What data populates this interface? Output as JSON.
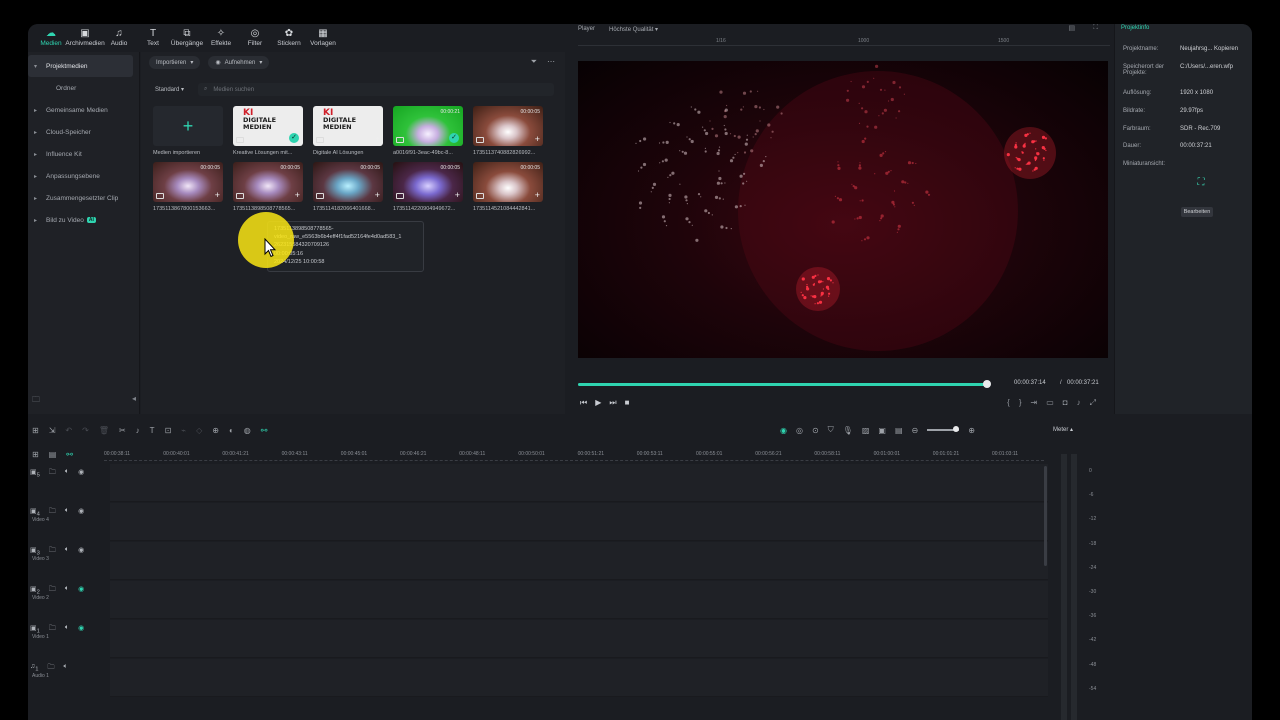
{
  "toolbar": {
    "items": [
      {
        "label": "Medien",
        "icon": "media-icon",
        "glyph": "☁"
      },
      {
        "label": "Archivmedien",
        "icon": "archive-icon",
        "glyph": "▣"
      },
      {
        "label": "Audio",
        "icon": "music-icon",
        "glyph": "♫"
      },
      {
        "label": "Text",
        "icon": "text-icon",
        "glyph": "T"
      },
      {
        "label": "Übergänge",
        "icon": "transition-icon",
        "glyph": "⧉"
      },
      {
        "label": "Effekte",
        "icon": "effects-icon",
        "glyph": "✧"
      },
      {
        "label": "Filter",
        "icon": "filter-icon",
        "glyph": "◎"
      },
      {
        "label": "Stickern",
        "icon": "sticker-icon",
        "glyph": "✿"
      },
      {
        "label": "Vorlagen",
        "icon": "template-icon",
        "glyph": "▦"
      }
    ]
  },
  "leftnav": {
    "items": [
      {
        "label": "Projektmedien",
        "caret": "▾",
        "selected": true
      },
      {
        "label": "Ordner",
        "sub": true
      },
      {
        "label": "Gemeinsame Medien",
        "caret": "▸"
      },
      {
        "label": "Cloud-Speicher",
        "caret": "▸"
      },
      {
        "label": "Influence Kit",
        "caret": "▸"
      },
      {
        "label": "Anpassungsebene",
        "caret": "▸"
      },
      {
        "label": "Zusammengesetzter Clip",
        "caret": "▸"
      },
      {
        "label": "Bild zu Video",
        "caret": "▸",
        "badge": "AI"
      }
    ]
  },
  "media": {
    "import_label": "Importieren",
    "record_label": "Aufnehmen",
    "sort_label": "Standard",
    "search_placeholder": "Medien suchen",
    "tiles": [
      {
        "label": "Medien importieren",
        "kind": "import"
      },
      {
        "label": "Kreative Lösungen mit...",
        "kind": "ki",
        "check": true
      },
      {
        "label": "Digitale AI Lösungen",
        "kind": "ki",
        "plus": true
      },
      {
        "label": "a0016f91-3eac-49bc-8...",
        "kind": "green",
        "duration": "00:00:21",
        "check": true
      },
      {
        "label": "1735113740882826992...",
        "kind": "brown",
        "duration": "00:00:05",
        "plus": true
      },
      {
        "label": "1735113867800153663...",
        "kind": "dancer",
        "duration": "00:00:05",
        "plus": true
      },
      {
        "label": "1735113898508778565...",
        "kind": "dancer",
        "duration": "00:00:05",
        "plus": true
      },
      {
        "label": "1735114182066401668...",
        "kind": "dancer2",
        "duration": "00:00:05",
        "plus": true
      },
      {
        "label": "1735114220904949672...",
        "kind": "dancer3",
        "duration": "00:00:05",
        "plus": true
      },
      {
        "label": "1735114521084442841...",
        "kind": "brown",
        "duration": "00:00:05",
        "plus": true
      }
    ],
    "ki_logo": {
      "top": "KI",
      "line1": "DIGITALE",
      "line2": "MEDIEN"
    },
    "tooltip": {
      "line1": "1735113898508778565-",
      "line2": "video_raw_e5563b6b4eff4f1fad52164fe4d0ad583_1",
      "line3": "262315584320709126",
      "line4": "00:00:05:16",
      "line5": "2024/12/25 10:00:58"
    }
  },
  "player": {
    "label": "Player",
    "quality": "Höchste Qualität",
    "ruler": [
      "1/16",
      "1000",
      "1500"
    ],
    "time_current": "00:00:37:14",
    "time_separator": "/",
    "time_total": "00:00:37:21",
    "progress": 0.993
  },
  "info": {
    "tab": "Projektinfo",
    "rows": [
      {
        "k": "Projektname:",
        "v": "Neujahrsg... Kopieren"
      },
      {
        "k": "Speicherort der Projekte:",
        "v": "C:/Users/...eren.wfp"
      },
      {
        "k": "Auflösung:",
        "v": "1920 x 1080"
      },
      {
        "k": "Bildrate:",
        "v": "29.97fps"
      },
      {
        "k": "Farbraum:",
        "v": "SDR - Rec.709"
      },
      {
        "k": "Dauer:",
        "v": "00:00:37:21"
      },
      {
        "k": "Miniaturansicht:",
        "v": ""
      }
    ],
    "edit_label": "Bearbeiten"
  },
  "timeline": {
    "meter_label": "Meter",
    "ruler": [
      "00:00:38:11",
      "00:00:40:01",
      "00:00:41:21",
      "00:00:43:11",
      "00:00:45:01",
      "00:00:46:21",
      "00:00:48:11",
      "00:00:50:01",
      "00:00:51:21",
      "00:00:53:11",
      "00:00:55:01",
      "00:00:56:21",
      "00:00:58:11",
      "00:01:00:01",
      "00:01:01:21",
      "00:01:03:11"
    ],
    "tracks": [
      {
        "num": "5",
        "name": ""
      },
      {
        "num": "4",
        "name": "Video 4"
      },
      {
        "num": "3",
        "name": "Video 3"
      },
      {
        "num": "2",
        "name": "Video 2"
      },
      {
        "num": "1",
        "name": "Video 1"
      },
      {
        "num": "1",
        "name": "Audio 1"
      }
    ],
    "meter_scale": [
      "0",
      "-6",
      "-12",
      "-18",
      "-24",
      "-30",
      "-36",
      "-42",
      "-48",
      "-54"
    ]
  },
  "colors": {
    "accent": "#2fd4b0",
    "background": "#1b1d22",
    "cursor_highlight": "#f7e21a"
  }
}
